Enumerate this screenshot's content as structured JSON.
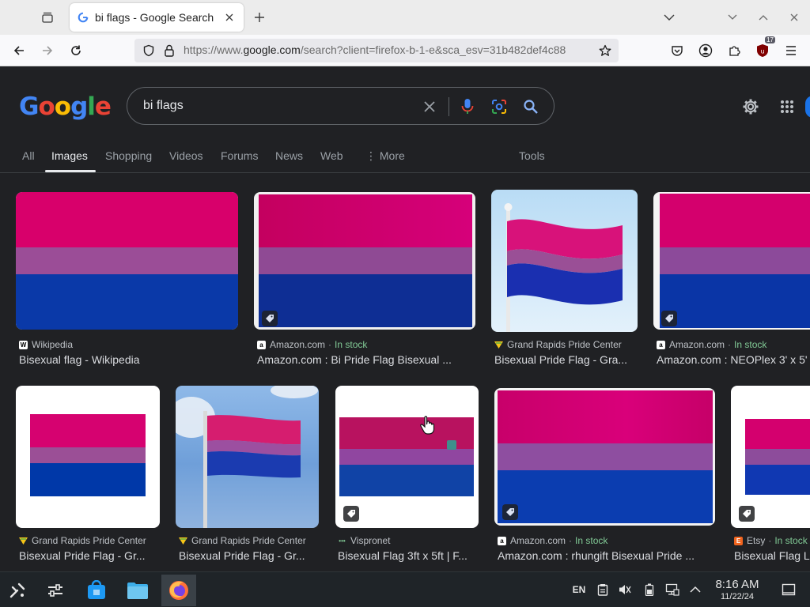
{
  "browser": {
    "tab_title": "bi flags - Google Search",
    "url_prefix": "https://www.",
    "url_domain": "google.com",
    "url_rest": "/search?client=firefox-b-1-e&sca_esv=31b482def4c88",
    "extension_badge": "17"
  },
  "google": {
    "logo": "Google",
    "query": "bi flags",
    "tabs": [
      "All",
      "Images",
      "Shopping",
      "Videos",
      "Forums",
      "News",
      "Web",
      "More",
      "Tools"
    ],
    "active_tab": "Images"
  },
  "results": [
    {
      "source": "Wikipedia",
      "stock": "",
      "title": "Bisexual flag - Wikipedia"
    },
    {
      "source": "Amazon.com",
      "stock": "In stock",
      "title": "Amazon.com : Bi Pride Flag Bisexual ..."
    },
    {
      "source": "Grand Rapids Pride Center",
      "stock": "",
      "title": "Bisexual Pride Flag - Gra..."
    },
    {
      "source": "Amazon.com",
      "stock": "In stock",
      "title": "Amazon.com : NEOPlex 3' x 5'"
    },
    {
      "source": "Grand Rapids Pride Center",
      "stock": "",
      "title": "Bisexual Pride Flag - Gr..."
    },
    {
      "source": "Grand Rapids Pride Center",
      "stock": "",
      "title": "Bisexual Pride Flag - Gr..."
    },
    {
      "source": "Vispronet",
      "stock": "",
      "title": "Bisexual Flag 3ft x 5ft | F..."
    },
    {
      "source": "Amazon.com",
      "stock": "In stock",
      "title": "Amazon.com : rhungift Bisexual Pride ..."
    },
    {
      "source": "Etsy",
      "stock": "In stock",
      "title": "Bisexual Flag L"
    }
  ],
  "colors": {
    "flag_pink": "#d6006f",
    "flag_purple": "#9a4f96",
    "flag_blue": "#0038a8"
  },
  "taskbar": {
    "lang": "EN",
    "time": "8:16 AM",
    "date": "11/22/24"
  }
}
